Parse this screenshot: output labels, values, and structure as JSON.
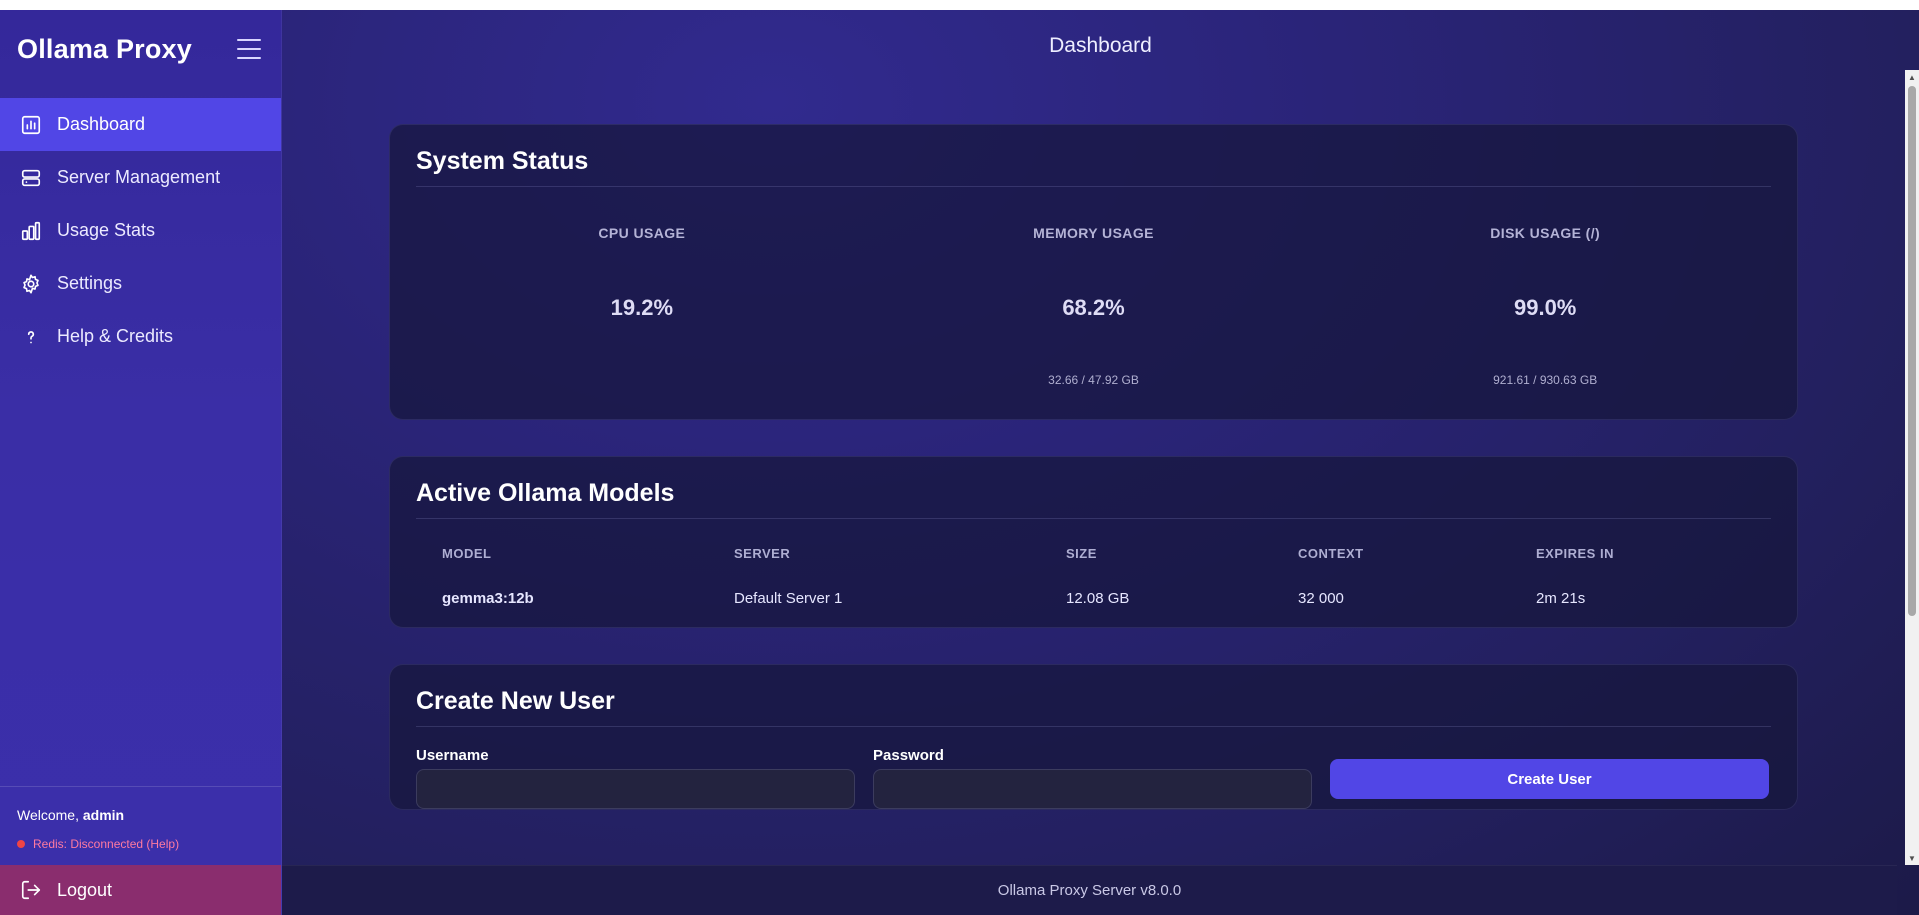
{
  "sidebar": {
    "brand": "Ollama Proxy",
    "menu_icon": "hamburger-icon",
    "items": [
      {
        "label": "Dashboard",
        "icon": "dashboard-icon",
        "active": true
      },
      {
        "label": "Server Management",
        "icon": "server-icon",
        "active": false
      },
      {
        "label": "Usage Stats",
        "icon": "bar-chart-icon",
        "active": false
      },
      {
        "label": "Settings",
        "icon": "gear-icon",
        "active": false
      },
      {
        "label": "Help & Credits",
        "icon": "help-icon",
        "active": false
      }
    ],
    "welcome_prefix": "Welcome,",
    "username": "admin",
    "redis_status": "Redis: Disconnected (Help)",
    "logout_label": "Logout"
  },
  "header": {
    "title": "Dashboard"
  },
  "system_status": {
    "title": "System Status",
    "stats": [
      {
        "label": "CPU USAGE",
        "value": "19.2%",
        "sub": ""
      },
      {
        "label": "MEMORY USAGE",
        "value": "68.2%",
        "sub": "32.66 / 47.92 GB"
      },
      {
        "label": "DISK USAGE (/)",
        "value": "99.0%",
        "sub": "921.61 / 930.63 GB"
      }
    ]
  },
  "models": {
    "title": "Active Ollama Models",
    "columns": [
      "MODEL",
      "SERVER",
      "SIZE",
      "CONTEXT",
      "EXPIRES IN"
    ],
    "rows": [
      [
        "gemma3:12b",
        "Default Server 1",
        "12.08 GB",
        "32 000",
        "2m 21s"
      ]
    ]
  },
  "create_user": {
    "title": "Create New User",
    "username_label": "Username",
    "password_label": "Password",
    "username_value": "",
    "password_value": "",
    "button_label": "Create User"
  },
  "footer": {
    "text": "Ollama Proxy Server v8.0.0"
  },
  "colors": {
    "accent": "#5146e6",
    "sidebar": "#3a2ea6",
    "logout": "#8a2d6e",
    "redis_error": "#ef4444"
  }
}
